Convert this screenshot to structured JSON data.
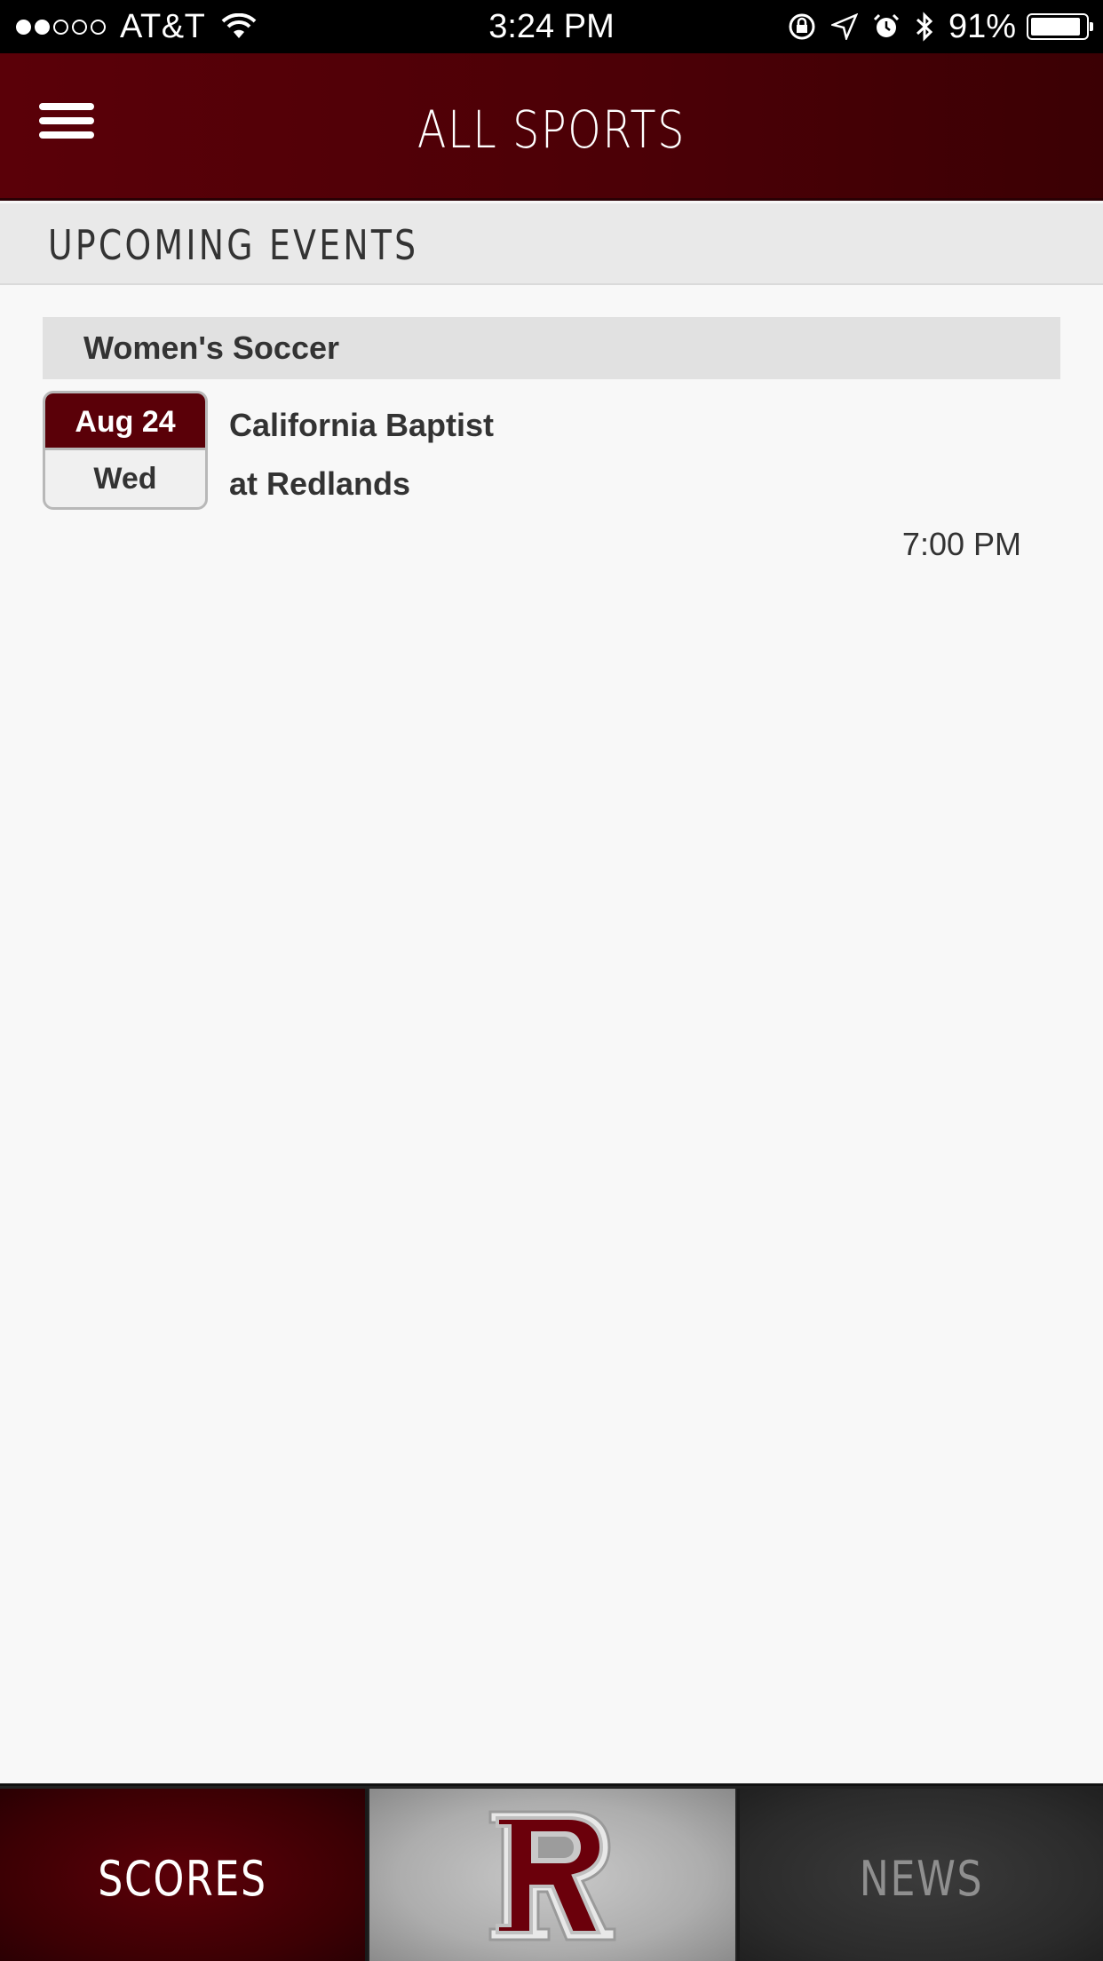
{
  "status_bar": {
    "carrier": "AT&T",
    "time": "3:24 PM",
    "battery_percent": "91%",
    "battery_level": 0.91,
    "signal_bars_filled": 2,
    "signal_bars_total": 5,
    "icons": [
      "wifi-icon",
      "rotation-lock-icon",
      "location-icon",
      "alarm-icon",
      "bluetooth-icon",
      "battery-icon"
    ]
  },
  "header": {
    "title": "ALL SPORTS",
    "menu_icon": "hamburger-menu-icon"
  },
  "section": {
    "title": "UPCOMING EVENTS"
  },
  "groups": [
    {
      "sport": "Women's Soccer",
      "events": [
        {
          "month_day": "Aug 24",
          "weekday": "Wed",
          "opponent": "California Baptist",
          "location": "at Redlands",
          "time": "7:00 PM"
        }
      ]
    }
  ],
  "tabs": {
    "scores_label": "SCORES",
    "home_logo": "redlands-r-logo",
    "news_label": "NEWS"
  },
  "colors": {
    "brand_maroon": "#5a0008",
    "background": "#f8f8f8",
    "section_bg": "#e9e9e9"
  }
}
